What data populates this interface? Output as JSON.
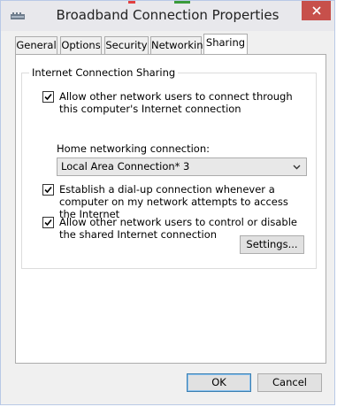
{
  "window": {
    "title": "Broadband Connection Properties",
    "icon": "network-connection-icon"
  },
  "tabs": [
    {
      "label": "General"
    },
    {
      "label": "Options"
    },
    {
      "label": "Security"
    },
    {
      "label": "Networking"
    },
    {
      "label": "Sharing",
      "active": true
    }
  ],
  "sharing": {
    "group_title": "Internet Connection Sharing",
    "allow_connect": {
      "label": "Allow other network users to connect through this computer's Internet connection",
      "checked": true
    },
    "home_network_label": "Home networking connection:",
    "home_network_value": "Local Area Connection* 3",
    "dialup": {
      "label": "Establish a dial-up connection whenever a computer on my network attempts to access the Internet",
      "checked": true
    },
    "allow_control": {
      "label": "Allow other network users to control or disable the shared Internet connection",
      "checked": true
    },
    "settings_label": "Settings..."
  },
  "footer": {
    "ok_label": "OK",
    "cancel_label": "Cancel"
  },
  "colors": {
    "close": "#c7504b",
    "accent_border": "#3c7fb1"
  }
}
